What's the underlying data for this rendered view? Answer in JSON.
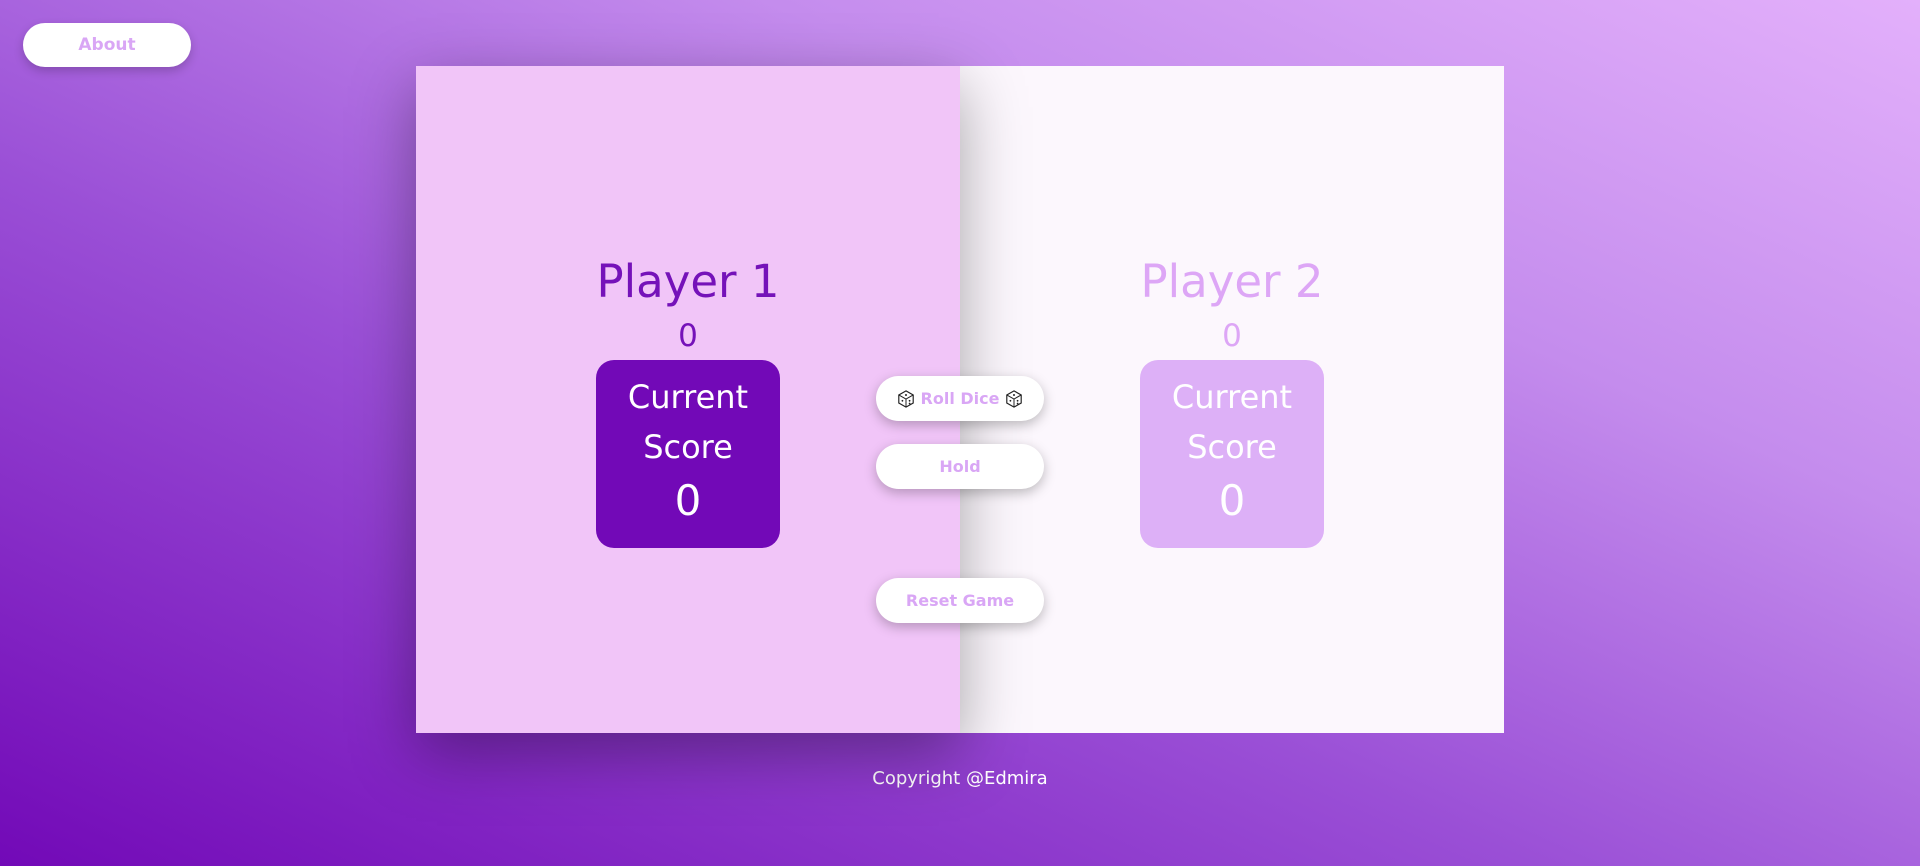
{
  "nav": {
    "about_label": "About"
  },
  "players": [
    {
      "name": "Player 1",
      "total_score": "0",
      "current_label": "Current Score",
      "current_score": "0",
      "active": true
    },
    {
      "name": "Player 2",
      "total_score": "0",
      "current_label": "Current Score",
      "current_score": "0",
      "active": false
    }
  ],
  "controls": {
    "roll_label": "Roll Dice",
    "roll_icon": "dice-icon",
    "hold_label": "Hold",
    "reset_label": "Reset Game"
  },
  "footer": {
    "copyright": "Copyright @Edmira"
  },
  "colors": {
    "accent": "#7209b7",
    "active_panel": "#f1c5f8",
    "inactive_panel": "#fcf7fd",
    "inactive_text": "#dda6f6",
    "button_text": "#d9a6f5"
  }
}
